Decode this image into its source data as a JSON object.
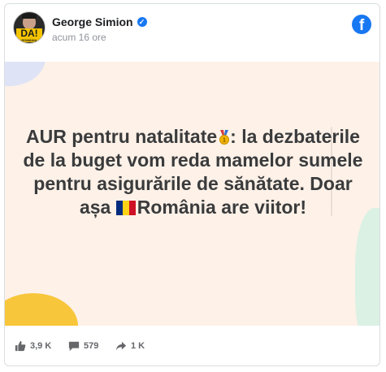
{
  "post": {
    "author": "George Simion",
    "time": "acum 16 ore",
    "avatar_badge": "DA!",
    "avatar_badge_sub": "ROMÂNIA",
    "text_part1": "AUR pentru natalitate",
    "text_part2": ": la dezbaterile de la buget vom reda mamelor sumele pentru asigurările de sănătate. Doar așa ",
    "text_part3": "România are viitor!",
    "background_color": "#fdf1e8",
    "icons": {
      "medal": "medal-icon",
      "flag": "romania-flag-icon",
      "platform": "facebook-icon"
    }
  },
  "stats": {
    "likes": "3,9 K",
    "comments": "579",
    "shares": "1 K"
  },
  "colors": {
    "brand_blue": "#1877f2",
    "text_dark": "#3a3b3c",
    "muted": "#65676b"
  }
}
